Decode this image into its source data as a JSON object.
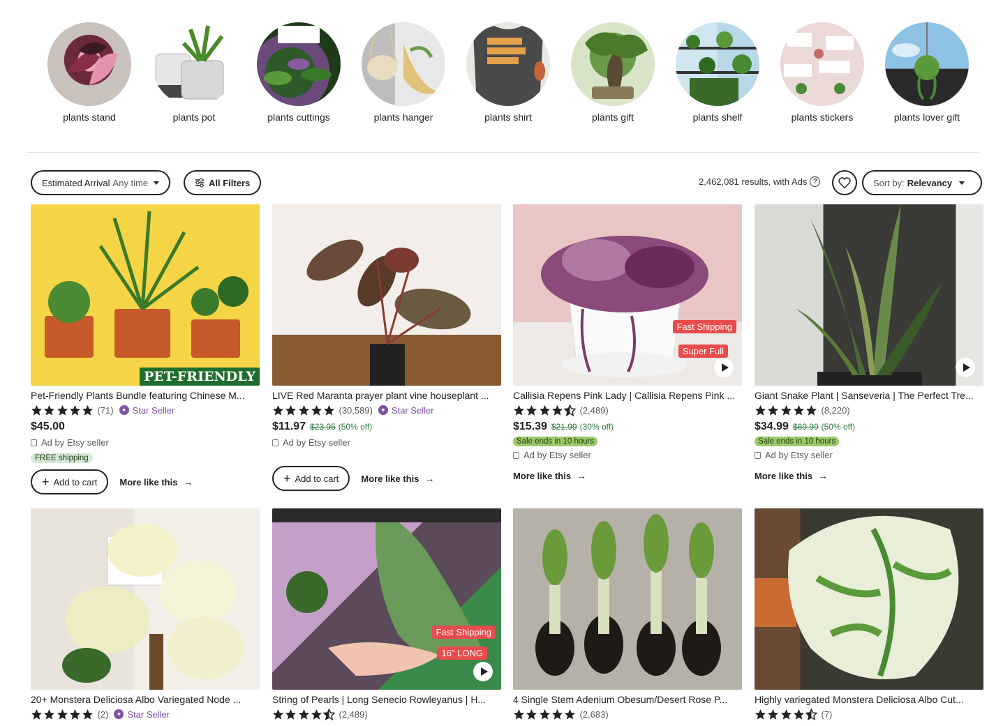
{
  "categories": [
    {
      "label": "plants stand"
    },
    {
      "label": "plants pot"
    },
    {
      "label": "plants cuttings"
    },
    {
      "label": "plants hanger"
    },
    {
      "label": "plants shirt"
    },
    {
      "label": "plants gift"
    },
    {
      "label": "plants shelf"
    },
    {
      "label": "plants stickers"
    },
    {
      "label": "plants lover gift"
    }
  ],
  "filters": {
    "arrival_label": "Estimated Arrival",
    "arrival_value": "Any time",
    "all_filters": "All Filters",
    "results_text": "2,462,081 results, with Ads",
    "sort_label": "Sort by:",
    "sort_value": "Relevancy"
  },
  "listings": [
    {
      "title": "Pet-Friendly Plants Bundle featuring Chinese M...",
      "reviews": "(71)",
      "star_seller": "Star Seller",
      "price": "$45.00",
      "ad": "Ad by Etsy seller",
      "free_shipping": "FREE shipping",
      "add_to_cart": "Add to cart",
      "more_like": "More like this",
      "tag": "PET-FRIENDLY"
    },
    {
      "title": "LIVE Red Maranta prayer plant vine houseplant ...",
      "reviews": "(30,589)",
      "star_seller": "Star Seller",
      "price": "$11.97",
      "orig_price": "$23.95",
      "discount": "(50% off)",
      "ad": "Ad by Etsy seller",
      "add_to_cart": "Add to cart",
      "more_like": "More like this"
    },
    {
      "title": "Callisia Repens Pink Lady | Callisia Repens Pink ...",
      "reviews": "(2,489)",
      "price": "$15.39",
      "orig_price": "$21.99",
      "discount": "(30% off)",
      "sale": "Sale ends in 10 hours",
      "ad": "Ad by Etsy seller",
      "more_like": "More like this",
      "overlay1": "Fast Shipping",
      "overlay2": "Super Full"
    },
    {
      "title": "Giant Snake Plant | Sanseveria | The Perfect Tre...",
      "reviews": "(8,220)",
      "price": "$34.99",
      "orig_price": "$69.99",
      "discount": "(50% off)",
      "sale": "Sale ends in 10 hours",
      "ad": "Ad by Etsy seller",
      "more_like": "More like this"
    },
    {
      "title": "20+ Monstera Deliciosa Albo Variegated Node ...",
      "reviews": "(2)",
      "star_seller": "Star Seller"
    },
    {
      "title": "String of Pearls | Long Senecio Rowleyanus | H...",
      "reviews": "(2,489)",
      "overlay1": "Fast Shipping",
      "overlay2": "16\" LONG"
    },
    {
      "title": "4 Single Stem Adenium Obesum/Desert Rose P...",
      "reviews": "(2,683)"
    },
    {
      "title": "Highly variegated Monstera Deliciosa Albo Cut...",
      "reviews": "(7)"
    }
  ],
  "ratings": [
    5,
    5,
    4.5,
    5,
    5,
    4.5,
    5,
    4.5
  ],
  "colors": {
    "star_seller": "#7f51a3",
    "sale_badge": "#9ec96b",
    "discount": "#2c7a3f",
    "free_shipping": "#d4e9d7"
  }
}
